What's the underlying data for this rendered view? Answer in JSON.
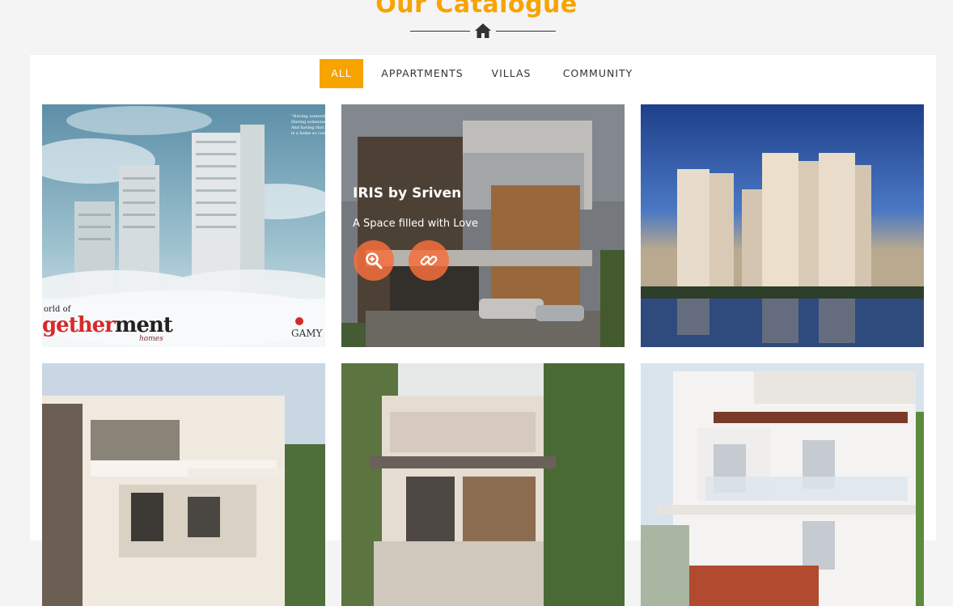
{
  "heading": "Our Catalogue",
  "filters": [
    "ALL",
    "APPARTMENTS",
    "VILLAS",
    "COMMUNITY"
  ],
  "active_filter": "ALL",
  "accent_color": "#f7a300",
  "icons": [
    "home-icon",
    "zoom-icon",
    "link-icon"
  ],
  "cards": [
    {
      "brand_prefix": "orld of",
      "brand_main_red": "gether",
      "brand_main_dark": "ment",
      "brand_sub": "homes",
      "brand_logo": "GAMY",
      "quote": "\"Having somewhere\nHaving someone to\nAnd having that tog\nis a home so comple"
    },
    {
      "overlay_title": "IRIS by Sriven",
      "overlay_subtitle": "A Space filled with Love"
    },
    {},
    {},
    {},
    {}
  ]
}
